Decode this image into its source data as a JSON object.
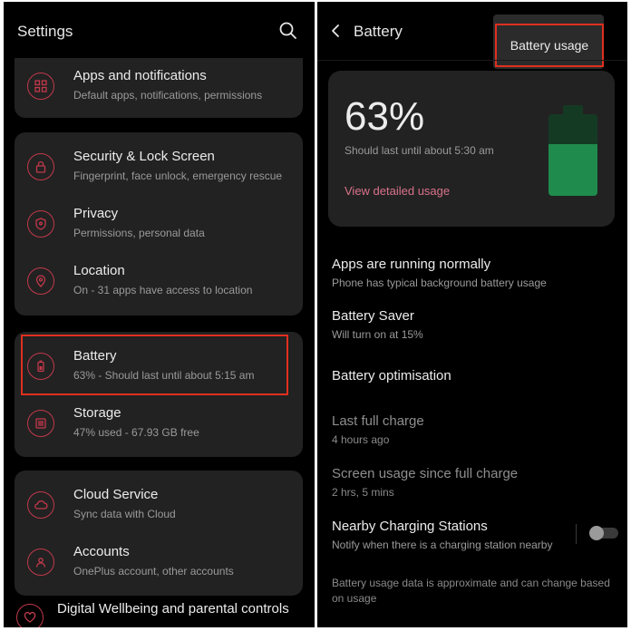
{
  "left": {
    "title": "Settings",
    "items": [
      {
        "label": "Apps and notifications",
        "sub": "Default apps, notifications, permissions"
      },
      {
        "label": "Security & Lock Screen",
        "sub": "Fingerprint, face unlock, emergency rescue"
      },
      {
        "label": "Privacy",
        "sub": "Permissions, personal data"
      },
      {
        "label": "Location",
        "sub": "On - 31 apps have access to location"
      },
      {
        "label": "Battery",
        "sub": "63% - Should last until about 5:15 am"
      },
      {
        "label": "Storage",
        "sub": "47% used - 67.93 GB free"
      },
      {
        "label": "Cloud Service",
        "sub": "Sync data with Cloud"
      },
      {
        "label": "Accounts",
        "sub": "OnePlus account, other accounts"
      },
      {
        "label": "Digital Wellbeing and parental controls"
      }
    ]
  },
  "right": {
    "title": "Battery",
    "menu_item": "Battery usage",
    "level_text": "63%",
    "level_fraction": 0.63,
    "estimate": "Should last until about 5:30 am",
    "view_link": "View detailed usage",
    "items": [
      {
        "label": "Apps are running normally",
        "sub": "Phone has typical background battery usage"
      },
      {
        "label": "Battery Saver",
        "sub": "Will turn on at 15%"
      },
      {
        "label": "Battery optimisation"
      },
      {
        "label": "Last full charge",
        "sub": "4 hours ago"
      },
      {
        "label": "Screen usage since full charge",
        "sub": "2 hrs, 5 mins"
      },
      {
        "label": "Nearby Charging Stations",
        "sub": "Notify when there is a charging station nearby"
      }
    ],
    "footer": "Battery usage data is approximate and can change based on usage"
  },
  "colors": {
    "accent": "#c2394b",
    "highlight": "#e0301e",
    "battery_fill": "#1f8b4c",
    "link": "#d9738a"
  }
}
